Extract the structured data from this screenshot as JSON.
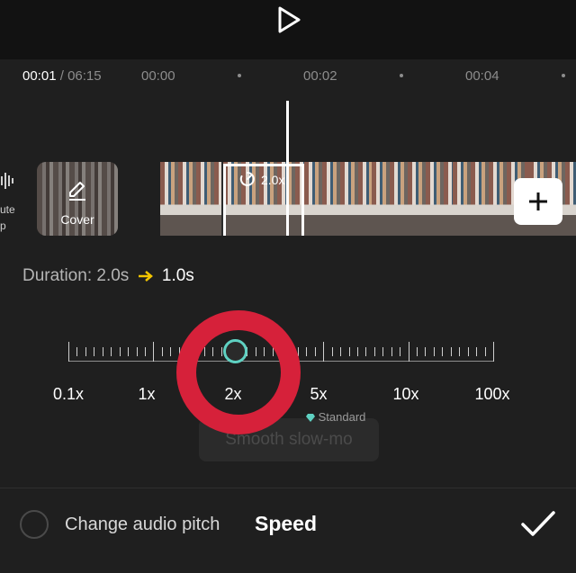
{
  "player": {
    "play_icon": "play-icon"
  },
  "timeline": {
    "current_time": "00:01",
    "separator": "/",
    "total_time": "06:15",
    "ruler_labels": [
      "00:00",
      "00:02",
      "00:04"
    ]
  },
  "track": {
    "mute_label_line1": "ute",
    "mute_label_line2": "p",
    "cover_label": "Cover",
    "clip_speed_badge": "2.0x"
  },
  "speed_panel": {
    "duration_label": "Duration:",
    "duration_from": "2.0s",
    "duration_to": "1.0s",
    "scale_labels": [
      "0.1x",
      "1x",
      "2x",
      "5x",
      "10x",
      "100x"
    ],
    "selected_speed": "2x",
    "smooth_slow_mo_label": "Smooth slow-mo",
    "standard_badge": "Standard"
  },
  "bottom_bar": {
    "pitch_label": "Change audio pitch",
    "title": "Speed"
  },
  "colors": {
    "accent": "#5fd1c2",
    "annotation": "#d6213a",
    "arrow": "#f2c500"
  }
}
